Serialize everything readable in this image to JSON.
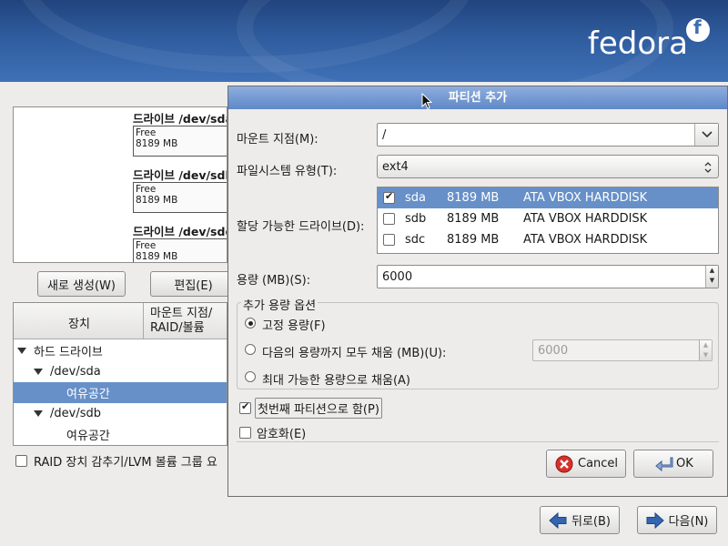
{
  "brand": {
    "logo_text": "fedora"
  },
  "drives": [
    {
      "title": "드라이브 /dev/sda",
      "free_label": "Free",
      "free_size": "8189 MB"
    },
    {
      "title": "드라이브 /dev/sdb",
      "free_label": "Free",
      "free_size": "8189 MB"
    },
    {
      "title": "드라이브 /dev/sdc",
      "free_label": "Free",
      "free_size": "8189 MB"
    }
  ],
  "left_buttons": {
    "create": "새로 생성(W)",
    "edit": "편집(E)"
  },
  "tree": {
    "col_device": "장치",
    "col_mount_line1": "마운트 지점/",
    "col_mount_line2": "RAID/볼륨",
    "rows": [
      "하드 드라이브",
      "/dev/sda",
      "여유공간",
      "/dev/sdb",
      "여유공간"
    ]
  },
  "raid_checkbox_label": "RAID 장치 감추기/LVM 볼륨 그룹 요",
  "dialog": {
    "title": "파티션 추가",
    "mount_label": "마운트 지점(M):",
    "mount_value": "/",
    "fs_label": "파일시스템 유형(T):",
    "fs_value": "ext4",
    "drives_label": "할당 가능한 드라이브(D):",
    "drive_list": [
      {
        "name": "sda",
        "size": "8189 MB",
        "model": "ATA VBOX HARDDISK",
        "checked": true
      },
      {
        "name": "sdb",
        "size": "8189 MB",
        "model": "ATA VBOX HARDDISK",
        "checked": false
      },
      {
        "name": "sdc",
        "size": "8189 MB",
        "model": "ATA VBOX HARDDISK",
        "checked": false
      }
    ],
    "size_label": "용량 (MB)(S):",
    "size_value": "6000",
    "options_title": "추가 용량 옵션",
    "opt_fixed": "고정 용량(F)",
    "opt_fill_to": "다음의 용량까지 모두 채움 (MB)(U):",
    "opt_fill_to_value": "6000",
    "opt_fill_max": "최대 가능한 용량으로 채움(A)",
    "primary_label": "첫번째 파티션으로 함(P)",
    "encrypt_label": "암호화(E)",
    "cancel_label": "Cancel",
    "ok_label": "OK"
  },
  "nav": {
    "back": "뒤로(B)",
    "next": "다음(N)"
  },
  "colors": {
    "selection": "#6790c8",
    "banner": "#2f5c9e",
    "cancel_icon": "#d8302b",
    "arrow_icon": "#3565b0"
  }
}
